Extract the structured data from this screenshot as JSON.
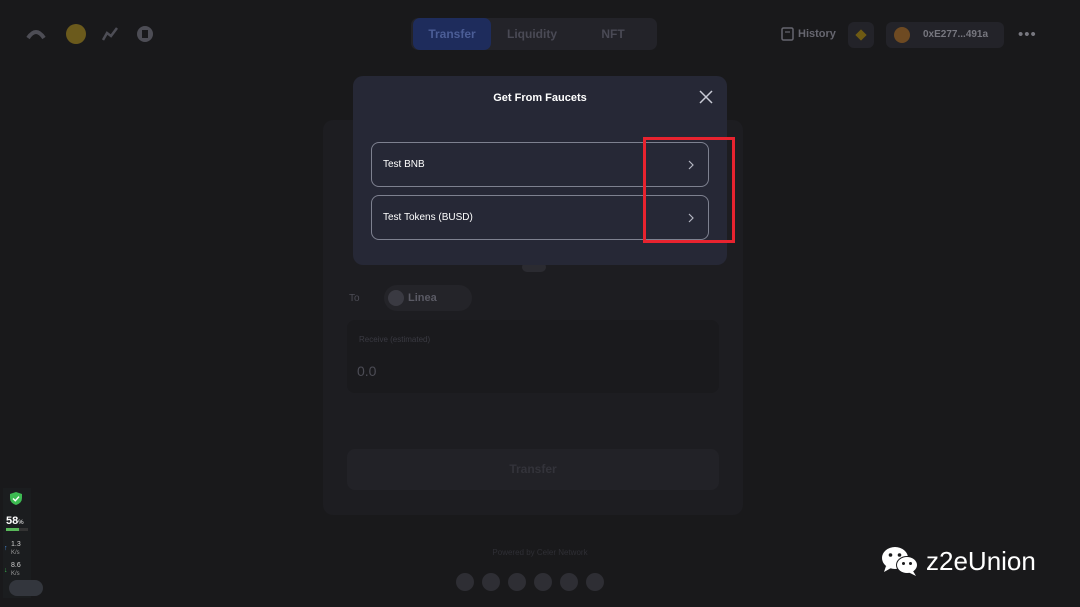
{
  "nav": {
    "tabs": [
      {
        "label": "Transfer",
        "active": true
      },
      {
        "label": "Liquidity",
        "active": false
      },
      {
        "label": "NFT",
        "active": false
      }
    ],
    "history_label": "History",
    "wallet_address": "0xE277...491a",
    "more_label": "•••"
  },
  "bridge": {
    "to_label": "To",
    "to_chain": "Linea",
    "receive_label": "Receive (estimated)",
    "receive_value": "0.0",
    "transfer_button": "Transfer",
    "powered_by": "Powered by Celer Network"
  },
  "modal": {
    "title": "Get From Faucets",
    "items": [
      {
        "label": "Test BNB"
      },
      {
        "label": "Test Tokens (BUSD)"
      }
    ]
  },
  "system_widget": {
    "percent": "58",
    "percent_unit": "%",
    "percent_level": 0.58,
    "upload_rate": "1.3",
    "download_rate": "8.6",
    "rate_unit": "K/s"
  },
  "watermark": {
    "text": "z2eUnion"
  },
  "colors": {
    "highlight": "#e8232f",
    "modal_bg": "#262836",
    "page_bg": "#19191b",
    "tab_active": "#1e2c5c"
  },
  "icons": [
    "logo-icon",
    "rocket-icon",
    "chart-icon",
    "docs-icon",
    "history-icon",
    "bnb-chain-icon",
    "close-icon",
    "chevron-right-icon",
    "shield-icon",
    "wechat-icon"
  ]
}
